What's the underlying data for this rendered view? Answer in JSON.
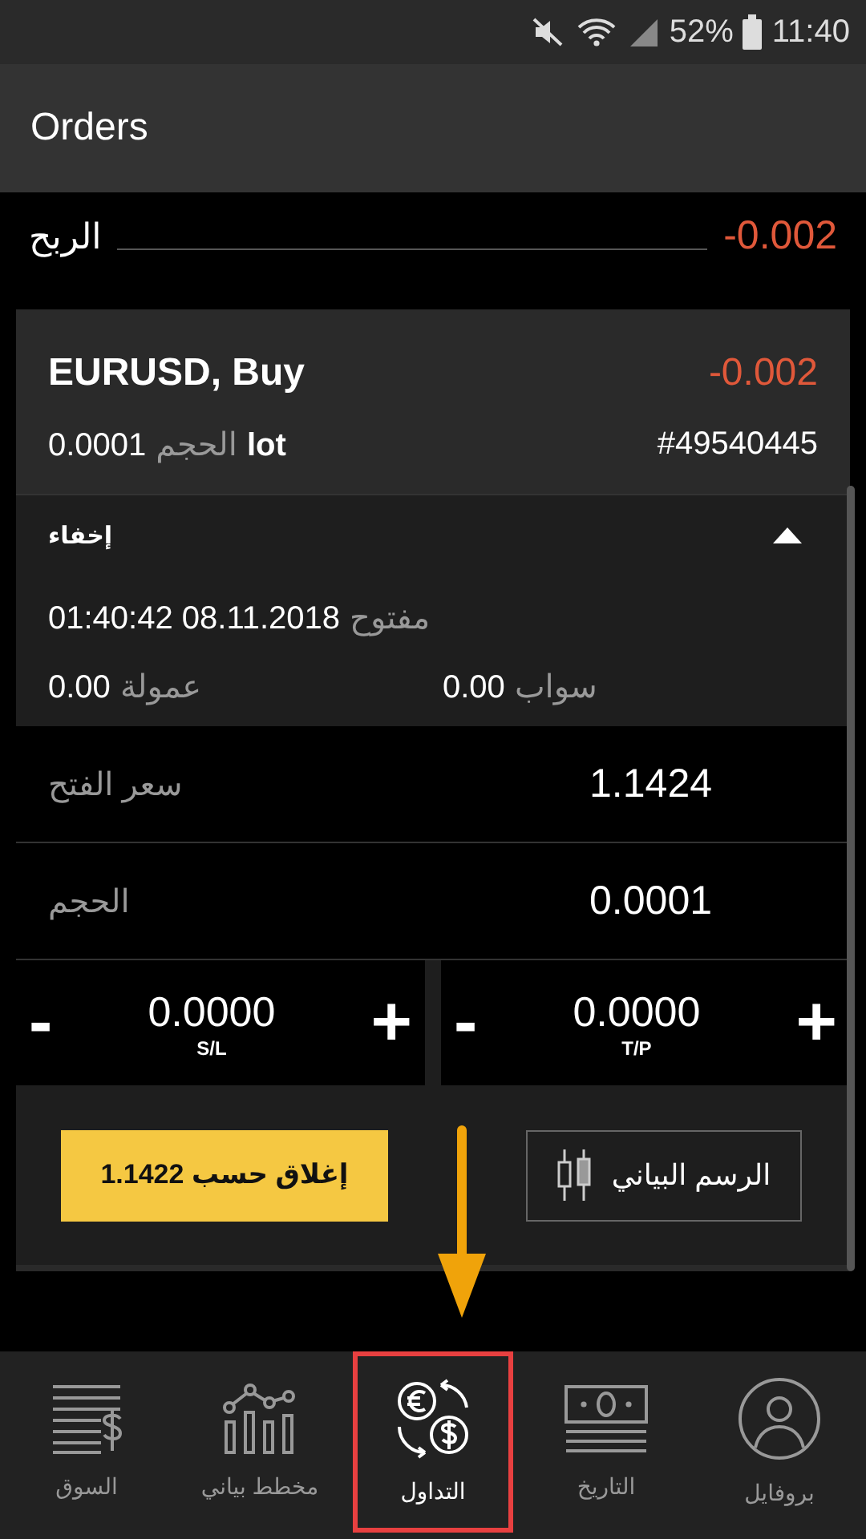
{
  "status_bar": {
    "battery": "52%",
    "time": "11:40"
  },
  "app_bar": {
    "title": "Orders"
  },
  "total": {
    "label": "الربح",
    "value": "-0.002"
  },
  "order": {
    "symbol": "EURUSD, Buy",
    "profit": "-0.002",
    "volume_value": "0.0001",
    "volume_label": "الحجم",
    "volume_unit": "lot",
    "ticket": "#49540445",
    "details": {
      "toggle_label": "إخفاء",
      "expanded": true,
      "open_label": "مفتوح",
      "open_time": "01:40:42 08.11.2018",
      "commission_label": "عمولة",
      "commission": "0.00",
      "swap_label": "سواب",
      "swap": "0.00"
    },
    "rows": [
      {
        "label": "سعر الفتح",
        "value": "1.1424"
      },
      {
        "label": "الحجم",
        "value": "0.0001"
      }
    ],
    "steppers": [
      {
        "minus": "-",
        "value": "0.0000",
        "plus": "+",
        "caption": "T/P"
      },
      {
        "minus": "-",
        "value": "0.0000",
        "plus": "+",
        "caption": "S/L"
      }
    ],
    "close_button": "إغلاق حسب 1.1422",
    "chart_button": "الرسم البياني"
  },
  "bottom_nav": [
    {
      "kind": "profile",
      "label": "بروفايل",
      "selected": false
    },
    {
      "kind": "history",
      "label": "التاريخ",
      "selected": false
    },
    {
      "kind": "trade",
      "label": "التداول",
      "selected": true
    },
    {
      "kind": "chart",
      "label": "مخطط بياني",
      "selected": false
    },
    {
      "kind": "market",
      "label": "السوق",
      "selected": false
    }
  ]
}
